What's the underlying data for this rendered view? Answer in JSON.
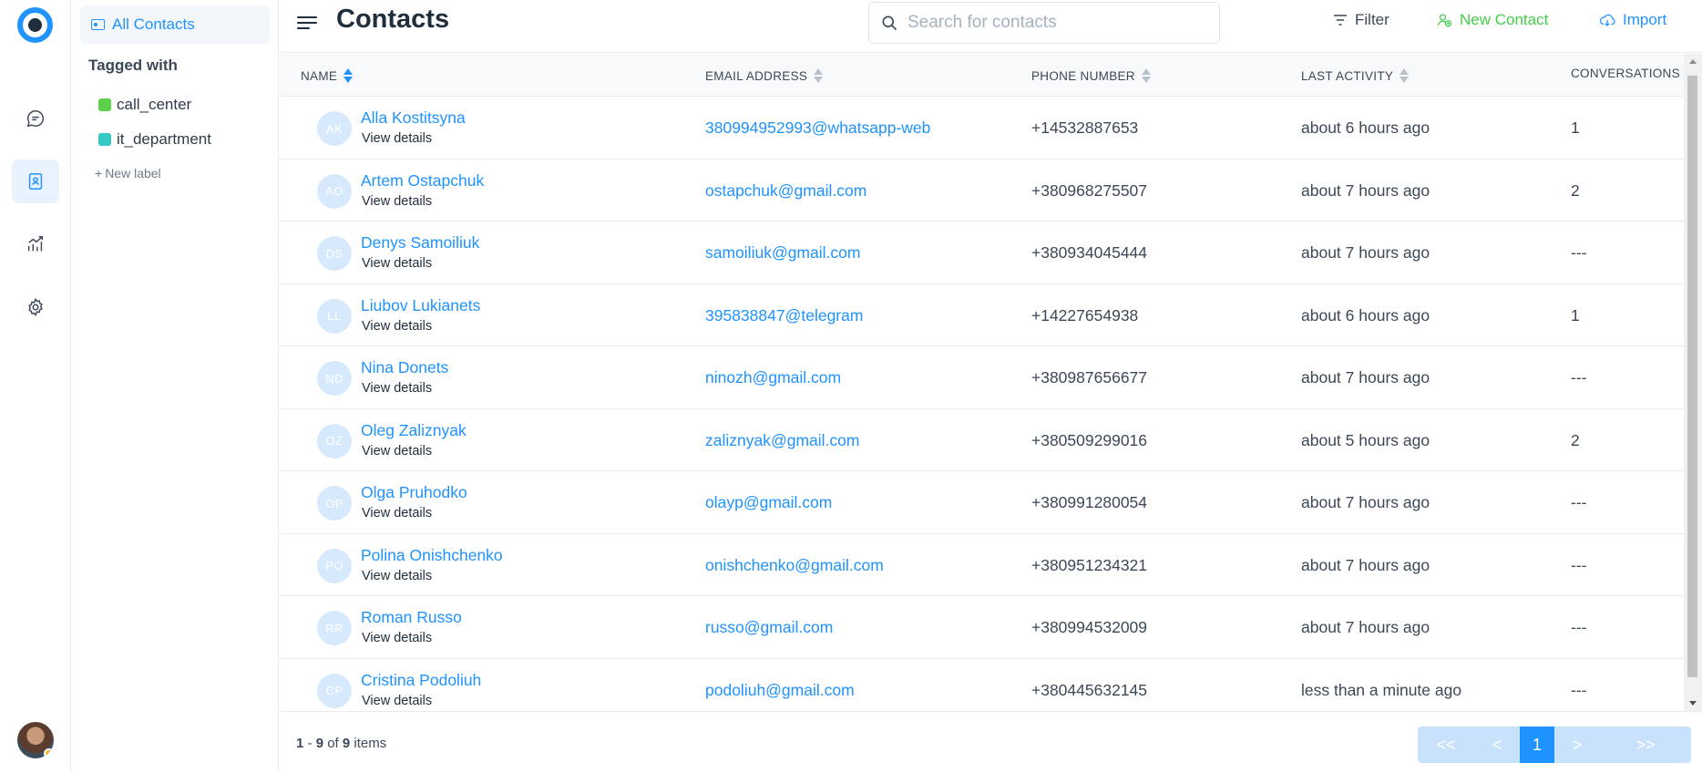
{
  "sidebar": {
    "all_contacts": "All Contacts",
    "tagged_with": "Tagged with",
    "tags": [
      {
        "label": "call_center",
        "color": "#5cd04a"
      },
      {
        "label": "it_department",
        "color": "#36c9c6"
      }
    ],
    "new_label": "New label"
  },
  "header": {
    "title": "Contacts",
    "search_placeholder": "Search for contacts",
    "filter": "Filter",
    "new_contact": "New Contact",
    "import": "Import"
  },
  "table": {
    "columns": [
      "NAME",
      "EMAIL ADDRESS",
      "PHONE NUMBER",
      "LAST ACTIVITY",
      "CONVERSATIONS"
    ],
    "view_details": "View details",
    "rows": [
      {
        "initials": "AK",
        "name": "Alla Kostitsyna",
        "email": "380994952993@whatsapp-web",
        "phone": "+14532887653",
        "activity": "about 6 hours ago",
        "conversations": "1"
      },
      {
        "initials": "AO",
        "name": "Artem Ostapchuk",
        "email": "ostapchuk@gmail.com",
        "phone": "+380968275507",
        "activity": "about 7 hours ago",
        "conversations": "2"
      },
      {
        "initials": "DS",
        "name": "Denys Samoiliuk",
        "email": "samoiliuk@gmail.com",
        "phone": "+380934045444",
        "activity": "about 7 hours ago",
        "conversations": "---"
      },
      {
        "initials": "LL",
        "name": "Liubov Lukianets",
        "email": "395838847@telegram",
        "phone": "+14227654938",
        "activity": "about 6 hours ago",
        "conversations": "1"
      },
      {
        "initials": "ND",
        "name": "Nina Donets",
        "email": "ninozh@gmail.com",
        "phone": "+380987656677",
        "activity": "about 7 hours ago",
        "conversations": "---"
      },
      {
        "initials": "OZ",
        "name": "Oleg Zaliznyak",
        "email": "zaliznyak@gmail.com",
        "phone": "+380509299016",
        "activity": "about 5 hours ago",
        "conversations": "2"
      },
      {
        "initials": "OP",
        "name": "Olga Pruhodko",
        "email": "olayp@gmail.com",
        "phone": "+380991280054",
        "activity": "about 7 hours ago",
        "conversations": "---"
      },
      {
        "initials": "PO",
        "name": "Polina Onishchenko",
        "email": "onishchenko@gmail.com",
        "phone": "+380951234321",
        "activity": "about 7 hours ago",
        "conversations": "---"
      },
      {
        "initials": "RR",
        "name": "Roman Russo",
        "email": "russo@gmail.com",
        "phone": "+380994532009",
        "activity": "about 7 hours ago",
        "conversations": "---"
      },
      {
        "initials": "CP",
        "name": "Cristina Podoliuh",
        "email": "podoliuh@gmail.com",
        "phone": "+380445632145",
        "activity": "less than a minute ago",
        "conversations": "---"
      }
    ]
  },
  "footer": {
    "range_start": "1",
    "range_sep": " - ",
    "range_end": "9",
    "of": " of ",
    "total": "9",
    "items": " items"
  },
  "pagination": {
    "first": "<<",
    "prev": "<",
    "current": "1",
    "next": ">",
    "last": ">>"
  },
  "colors": {
    "accent": "#1f93ff",
    "new_contact": "#44ce4b"
  }
}
